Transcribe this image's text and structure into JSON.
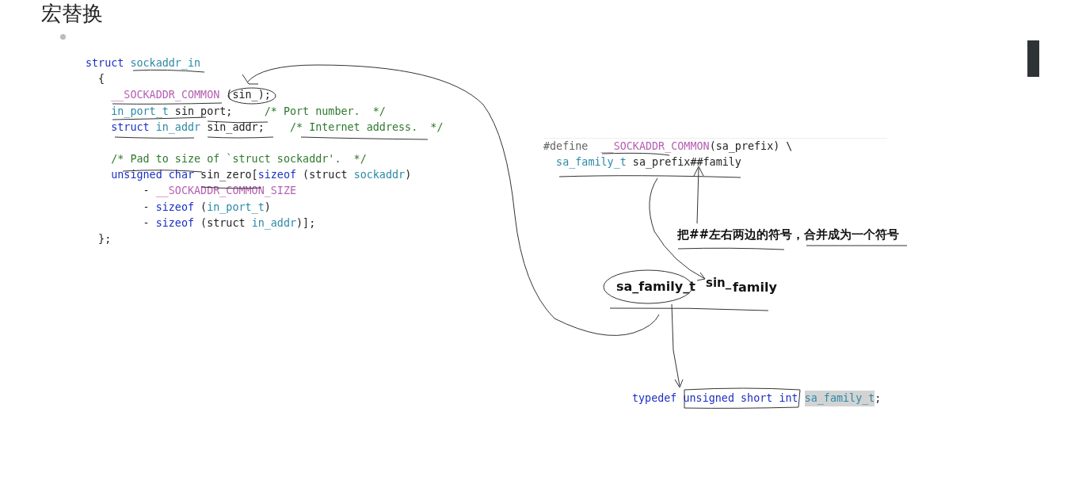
{
  "heading": "宏替换",
  "struct_code": {
    "groups": [
      {
        "lines": [
          {
            "tokens": [
              {
                "text": "struct",
                "kind": "keyword"
              },
              {
                "text": " sockaddr_in",
                "kind": "type"
              }
            ]
          },
          {
            "tokens": [
              {
                "text": "  {",
                "kind": "plain"
              }
            ]
          },
          {
            "tokens": [
              {
                "text": "    __SOCKADDR_COMMON",
                "kind": "macro"
              },
              {
                "text": " (sin_);",
                "kind": "plain"
              }
            ]
          },
          {
            "tokens": [
              {
                "text": "    in_port_t",
                "kind": "type"
              },
              {
                "text": " sin_port;     ",
                "kind": "plain"
              },
              {
                "text": "/* Port number.  */",
                "kind": "comment"
              }
            ]
          },
          {
            "tokens": [
              {
                "text": "    struct",
                "kind": "keyword"
              },
              {
                "text": " in_addr",
                "kind": "type"
              },
              {
                "text": " sin_addr;    ",
                "kind": "plain"
              },
              {
                "text": "/* Internet address.  */",
                "kind": "comment"
              }
            ]
          }
        ]
      },
      {
        "lines": [
          {
            "tokens": [
              {
                "text": "    /* Pad to size of `struct sockaddr'.  */",
                "kind": "comment"
              }
            ]
          },
          {
            "tokens": [
              {
                "text": "    unsigned char",
                "kind": "keyword"
              },
              {
                "text": " sin_zero[",
                "kind": "plain"
              },
              {
                "text": "sizeof",
                "kind": "keyword"
              },
              {
                "text": " (struct ",
                "kind": "plain"
              },
              {
                "text": "sockaddr",
                "kind": "type"
              },
              {
                "text": ")",
                "kind": "plain"
              }
            ]
          },
          {
            "tokens": [
              {
                "text": "         - ",
                "kind": "plain"
              },
              {
                "text": "__SOCKADDR_COMMON_SIZE",
                "kind": "macro"
              }
            ]
          },
          {
            "tokens": [
              {
                "text": "         - ",
                "kind": "plain"
              },
              {
                "text": "sizeof",
                "kind": "keyword"
              },
              {
                "text": " (",
                "kind": "plain"
              },
              {
                "text": "in_port_t",
                "kind": "type"
              },
              {
                "text": ")",
                "kind": "plain"
              }
            ]
          },
          {
            "tokens": [
              {
                "text": "         - ",
                "kind": "plain"
              },
              {
                "text": "sizeof",
                "kind": "keyword"
              },
              {
                "text": " (struct ",
                "kind": "plain"
              },
              {
                "text": "in_addr",
                "kind": "type"
              },
              {
                "text": ")];",
                "kind": "plain"
              }
            ]
          },
          {
            "tokens": [
              {
                "text": "  };",
                "kind": "plain"
              }
            ]
          }
        ]
      }
    ]
  },
  "define_code": {
    "lines": [
      {
        "tokens": [
          {
            "text": "#define  ",
            "kind": "directive"
          },
          {
            "text": "__SOCKADDR_COMMON",
            "kind": "macro"
          },
          {
            "text": "(sa_prefix) \\",
            "kind": "plain"
          }
        ]
      },
      {
        "tokens": [
          {
            "text": "  sa_family_t",
            "kind": "type"
          },
          {
            "text": " sa_prefix##family",
            "kind": "plain"
          }
        ]
      }
    ]
  },
  "note": "把##左右两边的符号，合并成为一个符号",
  "labels": {
    "type_name": "sa_family_t",
    "prefix": "sin_",
    "suffix": "family"
  },
  "typedef_code": {
    "tokens": [
      {
        "text": "typedef unsigned short int ",
        "kind": "keyword"
      },
      {
        "text": "sa_family_t",
        "kind": "selection"
      },
      {
        "text": ";",
        "kind": "plain"
      }
    ]
  }
}
